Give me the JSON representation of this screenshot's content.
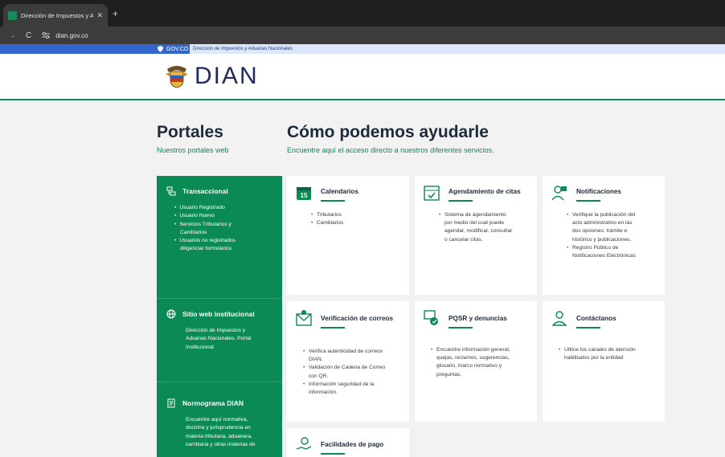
{
  "browser": {
    "tab_title": "Dirección de Impuestos y Adua",
    "tab_close": "✕",
    "new_tab": "+",
    "url": "dian.gov.co",
    "back": "←",
    "forward": "→",
    "reload": "C"
  },
  "govbar": {
    "gov_label": "GOV.CO",
    "link": "Dirección de Impuestos y Aduanas Nacionales"
  },
  "header": {
    "logo_text": "DIAN"
  },
  "portales": {
    "title": "Portales",
    "subtitle": "Nuestros portales web",
    "items": [
      {
        "title": "Transaccional",
        "bullets": [
          "Usuario Registrado",
          "Usuario Nuevo",
          "Servicios Tributarios y",
          "Cambiarios",
          "Usuarios no registrados",
          "diligenciar formularios"
        ]
      },
      {
        "title": "Sitio web institucional",
        "lines": [
          "Dirección de Impuestos y",
          "Aduanas Nacionales. Portal",
          "Institucional"
        ]
      },
      {
        "title": "Normograma DIAN",
        "lines": [
          "Encuentre aquí normativa,",
          "doctrina y jurisprudencia en",
          "materia tributaria, aduanera,",
          "cambiaria y otras materias de"
        ]
      }
    ]
  },
  "ayuda": {
    "title": "Cómo podemos ayudarle",
    "subtitle": "Encuentre aquí el acceso directo a nuestros diferentes servicios.",
    "cards": [
      {
        "title": "Calendarios",
        "lines": [
          "Tributarios",
          "Cambiarios"
        ]
      },
      {
        "title": "Agendamiento de citas",
        "lines": [
          "Sistema de agendamiento",
          "por medio del cual puede",
          "agendar, modificar, consultar",
          "o cancelar citas."
        ]
      },
      {
        "title": "Notificaciones",
        "lines": [
          "Verifique la publicación del",
          "acto administrativo en las",
          "dos opciones: trámite e",
          "histórico y publicaciones.",
          "Registro Público de",
          "Notificaciones Electrónicas"
        ]
      },
      {
        "title": "Verificación de correos",
        "lines": [
          "Verifica autenticidad de correos",
          "DIAN.",
          "Validación de Cadena de Correo",
          "con QR.",
          "Información seguridad de la",
          "información."
        ]
      },
      {
        "title": "PQSR y denuncias",
        "lines": [
          "Encuentre información general,",
          "quejas, reclamos, sugerencias,",
          "glosario, marco normativo y",
          "preguntas."
        ]
      },
      {
        "title": "Contáctanos",
        "lines": [
          "Utilice los canales de atención",
          "habilitados por la entidad"
        ]
      },
      {
        "title": "Facilidades de pago",
        "lines": []
      }
    ]
  },
  "colors": {
    "brand_green": "#0b8a55",
    "gov_blue": "#3366cc",
    "heading": "#1f2b3a"
  }
}
